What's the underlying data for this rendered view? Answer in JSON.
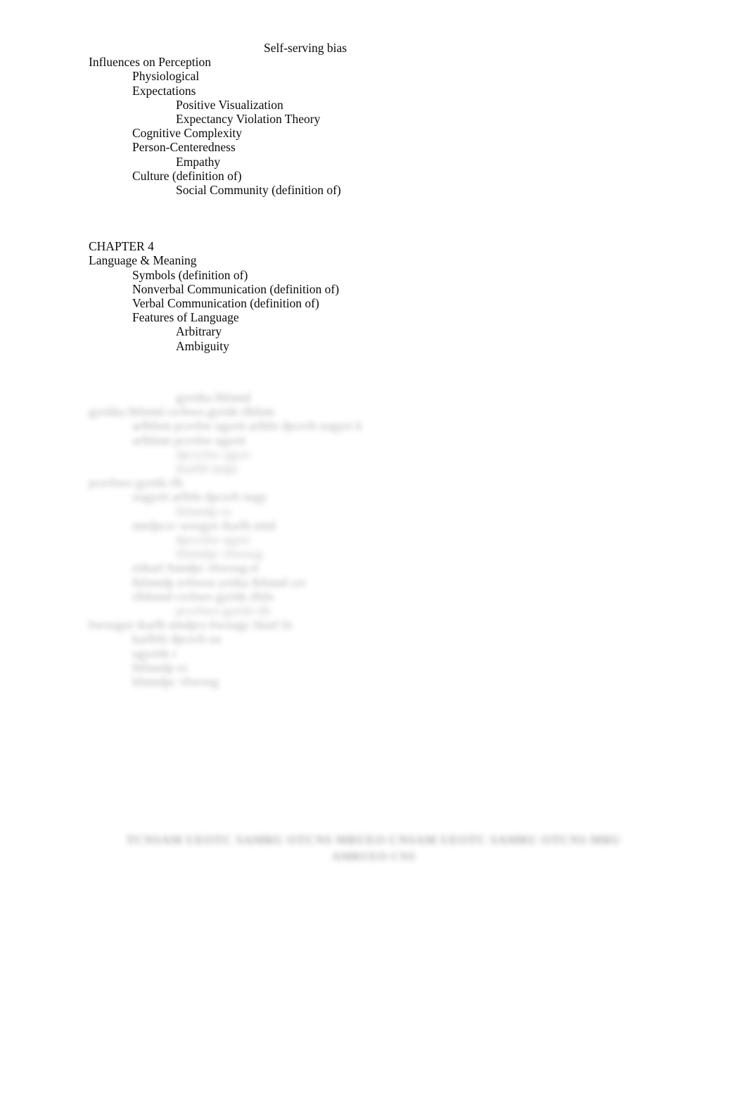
{
  "document": {
    "page_background": "#ffffff",
    "text_color": "#000000",
    "blurred_text_color": "#3a3a3a"
  },
  "visible_outline": {
    "chapter3_tail": [
      {
        "level": 3,
        "text": "Self-serving bias"
      },
      {
        "level": 0,
        "text": "Influences on Perception"
      },
      {
        "level": 1,
        "text": "Physiological"
      },
      {
        "level": 1,
        "text": "Expectations"
      },
      {
        "level": 2,
        "text": "Positive Visualization"
      },
      {
        "level": 2,
        "text": "Expectancy Violation Theory"
      },
      {
        "level": 1,
        "text": "Cognitive Complexity"
      },
      {
        "level": 1,
        "text": "Person-Centeredness"
      },
      {
        "level": 2,
        "text": "Empathy"
      },
      {
        "level": 1,
        "text": "Culture (definition of)"
      },
      {
        "level": 2,
        "text": "Social Community (definition of)"
      }
    ],
    "chapter4": [
      {
        "level": 0,
        "text": "CHAPTER 4"
      },
      {
        "level": 0,
        "text": "Language & Meaning"
      },
      {
        "level": 1,
        "text": "Symbols (definition of)"
      },
      {
        "level": 1,
        "text": "Nonverbal Communication (definition of)"
      },
      {
        "level": 1,
        "text": "Verbal Communication (definition of)"
      },
      {
        "level": 1,
        "text": "Features of Language"
      },
      {
        "level": 2,
        "text": "Arbitrary"
      },
      {
        "level": 2,
        "text": "Ambiguity"
      }
    ]
  },
  "redacted_outline": {
    "note": "blurred / illegible outline lines",
    "lines": [
      {
        "level": 2,
        "width_ch": 14,
        "deep": false
      },
      {
        "level": 0,
        "width_ch": 36,
        "deep": false
      },
      {
        "level": 1,
        "width_ch": 44,
        "deep": false
      },
      {
        "level": 1,
        "width_ch": 22,
        "deep": false
      },
      {
        "level": 2,
        "width_ch": 13,
        "deep": true
      },
      {
        "level": 2,
        "width_ch": 12,
        "deep": true
      },
      {
        "level": 0,
        "width_ch": 18,
        "deep": false
      },
      {
        "level": 1,
        "width_ch": 26,
        "deep": false
      },
      {
        "level": 2,
        "width_ch": 10,
        "deep": true
      },
      {
        "level": 1,
        "width_ch": 25,
        "deep": false
      },
      {
        "level": 2,
        "width_ch": 13,
        "deep": true
      },
      {
        "level": 2,
        "width_ch": 15,
        "deep": true
      },
      {
        "level": 1,
        "width_ch": 24,
        "deep": false
      },
      {
        "level": 1,
        "width_ch": 32,
        "deep": false
      },
      {
        "level": 1,
        "width_ch": 27,
        "deep": false
      },
      {
        "level": 2,
        "width_ch": 18,
        "deep": true
      },
      {
        "level": 0,
        "width_ch": 38,
        "deep": false
      },
      {
        "level": 1,
        "width_ch": 17,
        "deep": false
      },
      {
        "level": 1,
        "width_ch": 9,
        "deep": false
      },
      {
        "level": 1,
        "width_ch": 10,
        "deep": false
      },
      {
        "level": 1,
        "width_ch": 15,
        "deep": false
      }
    ]
  },
  "footer_heading": {
    "note": "blurred bold centered heading, two lines, illegible",
    "line1_width_ch": 58,
    "line2_width_ch": 10
  }
}
